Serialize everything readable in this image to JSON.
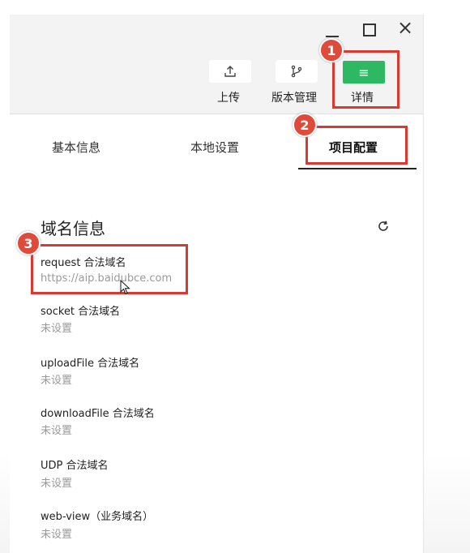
{
  "window": {
    "controls": {
      "minimize": "—",
      "maximize": "",
      "close": "×"
    }
  },
  "toolbar": {
    "upload": {
      "label": "上传",
      "icon": "upload-icon"
    },
    "version": {
      "label": "版本管理",
      "icon": "branch-icon"
    },
    "details": {
      "label": "详情",
      "icon": "menu-icon",
      "icon_glyph": "≡"
    }
  },
  "tabs": [
    {
      "label": "基本信息"
    },
    {
      "label": "本地设置"
    },
    {
      "label": "项目配置",
      "active": true
    }
  ],
  "section": {
    "title": "域名信息",
    "refresh_icon": "refresh-icon"
  },
  "domains": [
    {
      "label": "request 合法域名",
      "value": "https://aip.baidubce.com"
    },
    {
      "label": "socket 合法域名",
      "value": "未设置"
    },
    {
      "label": "uploadFile 合法域名",
      "value": "未设置"
    },
    {
      "label": "downloadFile 合法域名",
      "value": "未设置"
    },
    {
      "label": "UDP 合法域名",
      "value": "未设置"
    },
    {
      "label": "web-view（业务域名）",
      "value": "未设置"
    }
  ],
  "annotations": {
    "badge_1": "1",
    "badge_2": "2",
    "badge_3": "3",
    "color": "#d83a32"
  },
  "colors": {
    "accent_green": "#2fb864",
    "annotation_red": "#d83a32"
  }
}
